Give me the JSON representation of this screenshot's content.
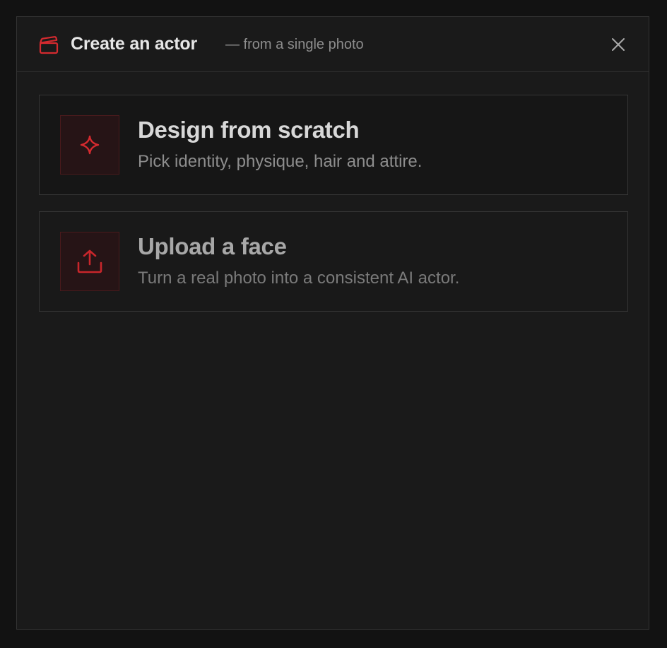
{
  "dialog": {
    "title": "Create an actor",
    "subtitle": "— from a single photo",
    "header_icon": "clapperboard-icon",
    "close_icon": "close-icon"
  },
  "options": [
    {
      "title": "Design from scratch",
      "description": "Pick identity, physique, hair and attire.",
      "icon": "sparkle-icon"
    },
    {
      "title": "Upload a face",
      "description": "Turn a real photo into a consistent AI actor.",
      "icon": "upload-icon"
    }
  ],
  "colors": {
    "accent": "#d42a2f",
    "background": "#1a1a1a",
    "page": "#121212"
  }
}
